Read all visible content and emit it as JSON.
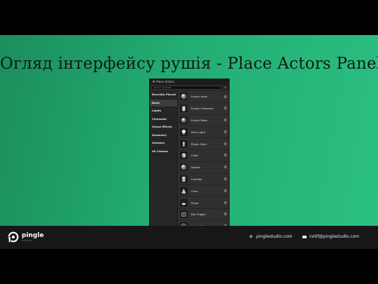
{
  "slide": {
    "title": "Огляд інтерфейсу рушія - Place Actors Panel"
  },
  "panel": {
    "header": "Place Actors",
    "search_placeholder": "Search Classes",
    "categories": [
      {
        "label": "Recently Placed"
      },
      {
        "label": "Basic"
      },
      {
        "label": "Lights"
      },
      {
        "label": "Cinematic"
      },
      {
        "label": "Visual Effects"
      },
      {
        "label": "Geometry"
      },
      {
        "label": "Volumes"
      },
      {
        "label": "All Classes"
      }
    ],
    "items": [
      {
        "label": "Empty Actor",
        "icon": "sphere-icon"
      },
      {
        "label": "Empty Character",
        "icon": "character-icon"
      },
      {
        "label": "Empty Pawn",
        "icon": "sphere-icon"
      },
      {
        "label": "Point Light",
        "icon": "light-bulb-icon"
      },
      {
        "label": "Player Start",
        "icon": "player-start-icon"
      },
      {
        "label": "Cube",
        "icon": "cube-icon"
      },
      {
        "label": "Sphere",
        "icon": "sphere-icon"
      },
      {
        "label": "Cylinder",
        "icon": "cylinder-icon"
      },
      {
        "label": "Cone",
        "icon": "cone-icon"
      },
      {
        "label": "Plane",
        "icon": "plane-icon"
      },
      {
        "label": "Box Trigger",
        "icon": "box-trigger-icon"
      },
      {
        "label": "Sphere Trigger",
        "icon": "sphere-trigger-icon"
      }
    ]
  },
  "footer": {
    "brand": "pingle",
    "brand_sub": "STUDIO",
    "website": "pinglestudio.com",
    "email": "notif@pinglestudio.com"
  },
  "colors": {
    "slide_gradient_start": "#1c8e5c",
    "slide_gradient_end": "#2bc081",
    "footer_bg": "#171717",
    "panel_bg": "#2a2a2a"
  }
}
